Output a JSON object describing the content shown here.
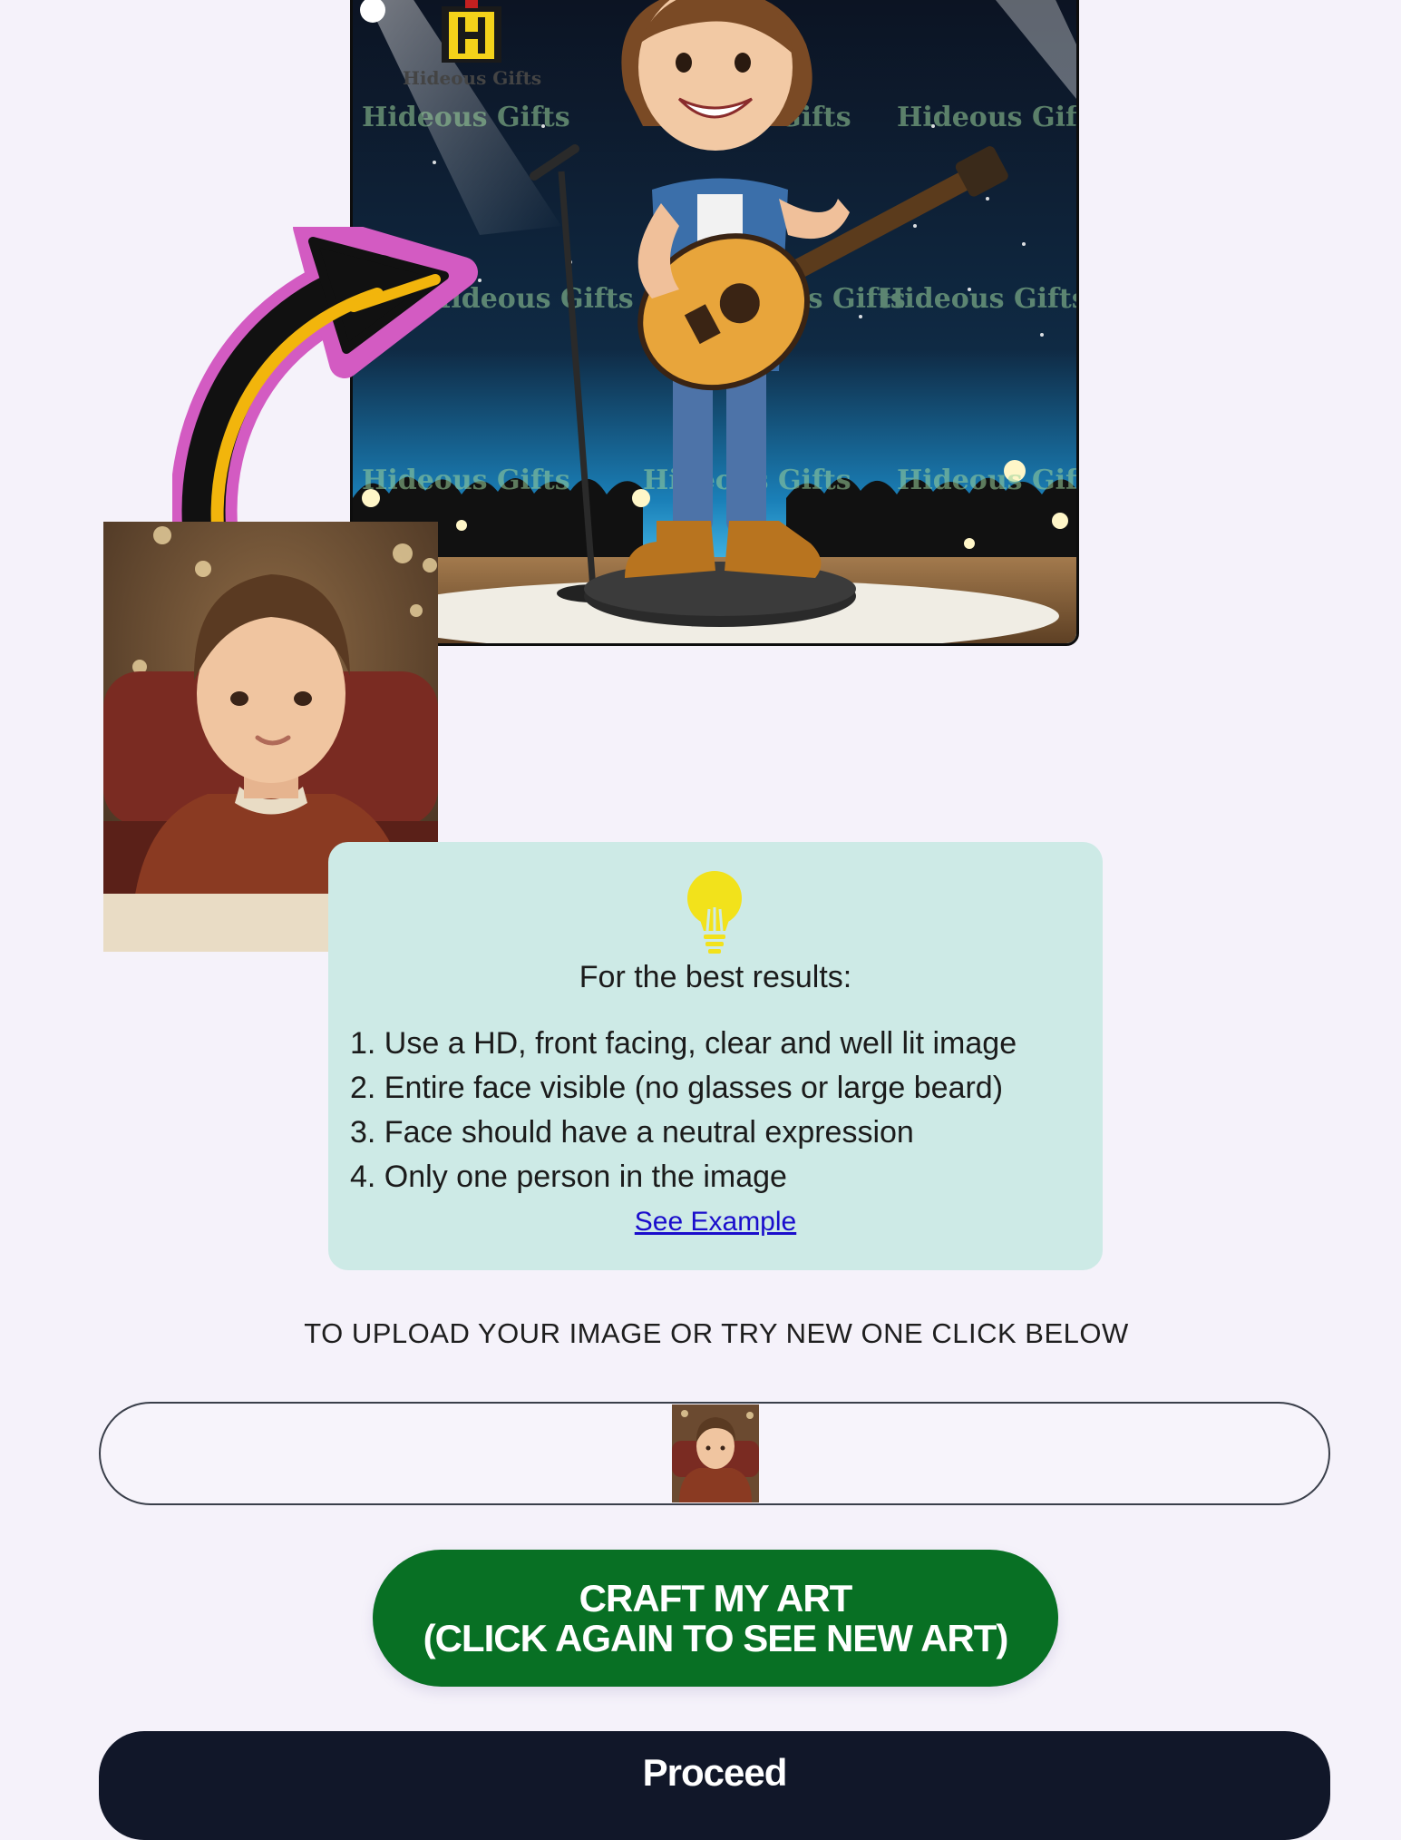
{
  "preview": {
    "watermark_brand": "Hideous Gifts",
    "watermark_text": "Hideous Gifts"
  },
  "tips": {
    "icon": "lightbulb-icon",
    "heading": "For the best results:",
    "items": [
      "1. Use a HD, front facing, clear and well lit image",
      "2. Entire face visible (no glasses or large beard)",
      "3. Face should have a neutral expression",
      "4. Only one person in the image"
    ],
    "see_example": "See Example"
  },
  "upload": {
    "label": "TO UPLOAD YOUR IMAGE OR TRY NEW ONE CLICK BELOW"
  },
  "buttons": {
    "craft_line1": "CRAFT MY ART",
    "craft_line2": "(CLICK AGAIN TO SEE NEW ART)",
    "proceed": "Proceed"
  },
  "colors": {
    "page_background": "#f5f2fa",
    "tips_background": "#cdeae6",
    "craft_button": "#087024",
    "proceed_button": "#111729",
    "link": "#1a0dcc",
    "arrow_outline": "#d35bc2",
    "arrow_fill": "#f2b50c",
    "bulb": "#f2e21b"
  }
}
